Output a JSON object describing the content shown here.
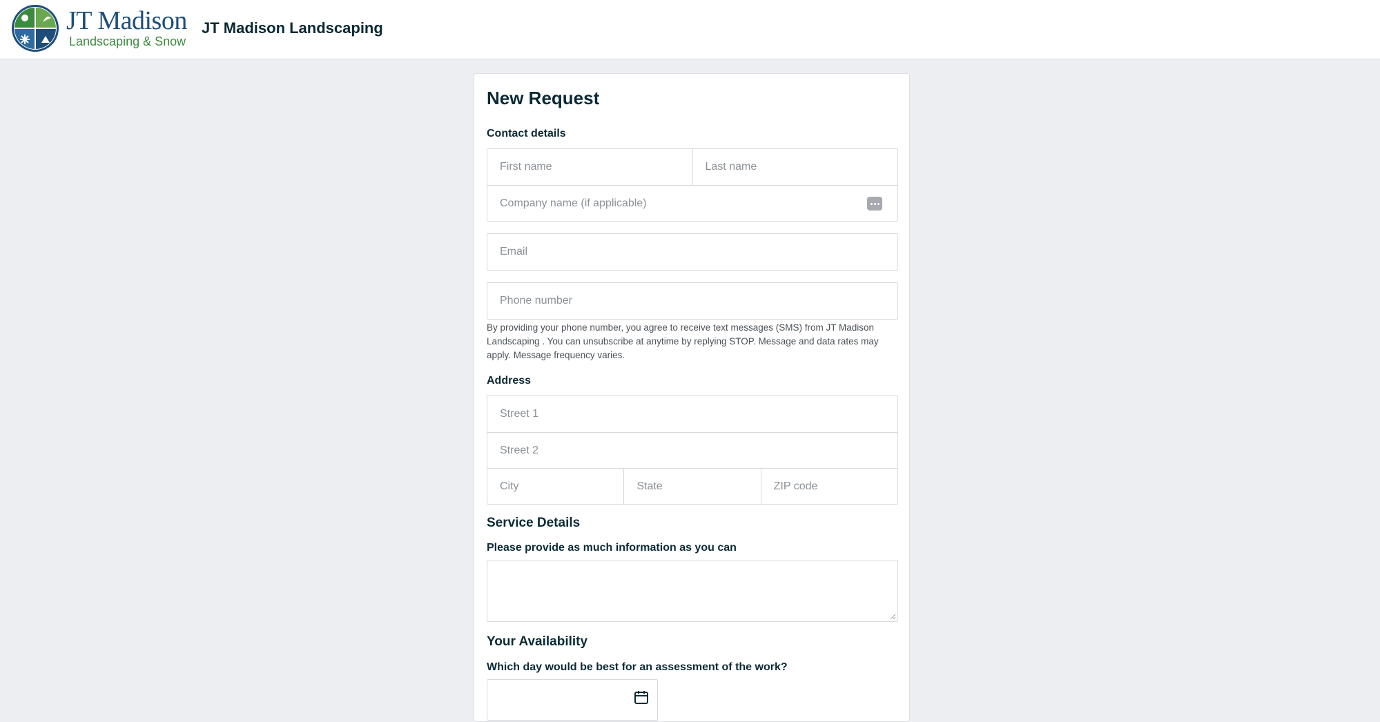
{
  "header": {
    "logo": {
      "title": "JT Madison",
      "subtitle": "Landscaping & Snow"
    },
    "company_name": "JT Madison Landscaping"
  },
  "form": {
    "title": "New Request",
    "contact": {
      "label": "Contact details",
      "first_name_placeholder": "First name",
      "last_name_placeholder": "Last name",
      "company_placeholder": "Company name (if applicable)",
      "email_placeholder": "Email",
      "phone_placeholder": "Phone number",
      "sms_notice": "By providing your phone number, you agree to receive text messages (SMS) from JT Madison Landscaping . You can unsubscribe at anytime by replying STOP. Message and data rates may apply. Message frequency varies."
    },
    "address": {
      "label": "Address",
      "street1_placeholder": "Street 1",
      "street2_placeholder": "Street 2",
      "city_placeholder": "City",
      "state_placeholder": "State",
      "zip_placeholder": "ZIP code"
    },
    "service": {
      "title": "Service Details",
      "label": "Please provide as much information as you can",
      "value": ""
    },
    "availability": {
      "title": "Your Availability",
      "label": "Which day would be best for an assessment of the work?",
      "date_value": ""
    }
  },
  "colors": {
    "page_bg": "#edeef1",
    "text_dark": "#0b2a35",
    "logo_blue": "#1d4e7a",
    "logo_green": "#3b8a3e"
  },
  "icons": [
    "password-manager-icon",
    "calendar-icon",
    "resize-grip-icon"
  ]
}
